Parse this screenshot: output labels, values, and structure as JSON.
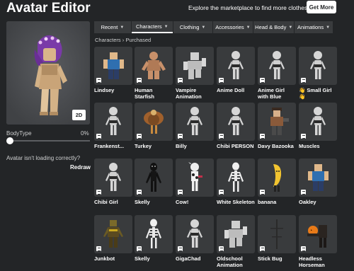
{
  "header": {
    "title": "Avatar Editor",
    "promo_text": "Explore the marketplace to find more clothes!",
    "get_more_label": "Get More"
  },
  "preview": {
    "mode_button_label": "2D"
  },
  "body_type": {
    "label": "BodyType",
    "value_text": "0%",
    "value": 0
  },
  "help": {
    "text": "Avatar isn't loading correctly?",
    "redraw_label": "Redraw"
  },
  "tabs": [
    {
      "label": "Recent",
      "active": false
    },
    {
      "label": "Characters",
      "active": true
    },
    {
      "label": "Clothing",
      "active": false
    },
    {
      "label": "Accessories",
      "active": false
    },
    {
      "label": "Head & Body",
      "active": false
    },
    {
      "label": "Animations",
      "active": false
    }
  ],
  "breadcrumb": {
    "text": "Characters › Purchased"
  },
  "items": [
    {
      "name": "Lindsey",
      "icon": "blocky-figure-icon"
    },
    {
      "name": "Human Starfish",
      "icon": "starfish-figure-icon"
    },
    {
      "name": "Vampire Animation",
      "icon": "animation-pose-icon"
    },
    {
      "name": "Anime Doll",
      "icon": "doll-figure-icon"
    },
    {
      "name": "Anime Girl with Blue",
      "icon": "doll-figure-icon"
    },
    {
      "name": "👋 Small Girl 👋",
      "icon": "doll-figure-icon"
    },
    {
      "name": "Frankenst...",
      "icon": "doll-figure-icon"
    },
    {
      "name": "Turkey",
      "icon": "turkey-figure-icon"
    },
    {
      "name": "Billy",
      "icon": "doll-figure-icon"
    },
    {
      "name": "Chibi PERSON",
      "icon": "doll-figure-icon"
    },
    {
      "name": "Davy Bazooka",
      "icon": "pirate-figure-icon"
    },
    {
      "name": "Muscles",
      "icon": "doll-figure-icon"
    },
    {
      "name": "Chibi Girl",
      "icon": "doll-figure-icon"
    },
    {
      "name": "Skelly",
      "icon": "dark-figure-icon"
    },
    {
      "name": "Cow!",
      "icon": "cow-figure-icon"
    },
    {
      "name": "White Skeleton",
      "icon": "skeleton-figure-icon"
    },
    {
      "name": "banana",
      "icon": "banana-figure-icon"
    },
    {
      "name": "Oakley",
      "icon": "blocky-figure-icon"
    },
    {
      "name": "Junkbot",
      "icon": "robot-figure-icon"
    },
    {
      "name": "Skelly",
      "icon": "skeleton-figure-icon"
    },
    {
      "name": "GigaChad",
      "icon": "doll-figure-icon"
    },
    {
      "name": "Oldschool Animation",
      "icon": "animation-pose-icon"
    },
    {
      "name": "Stick Bug",
      "icon": "stick-figure-icon"
    },
    {
      "name": "Headless Horseman",
      "icon": "pumpkin-figure-icon"
    }
  ],
  "colors": {
    "background": "#232527",
    "tile": "#393b3d",
    "text": "#ffffff",
    "muted_text": "#cfd0d1"
  }
}
